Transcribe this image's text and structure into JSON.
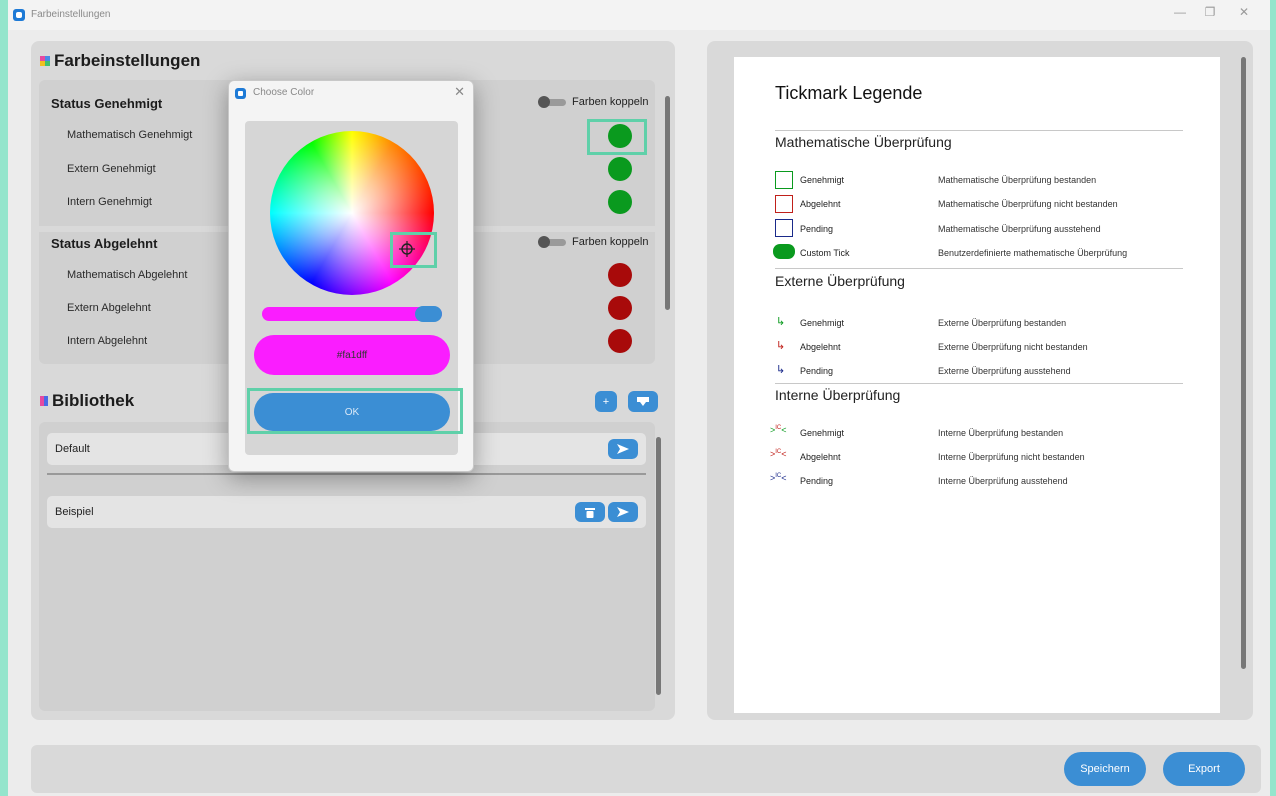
{
  "window": {
    "title": "Farbeinstellungen",
    "minimize": "—",
    "restore": "❐",
    "close": "✕"
  },
  "left": {
    "title": "Farbeinstellungen",
    "approved": {
      "title": "Status Genehmigt",
      "toggle": "Farben koppeln",
      "rows": [
        "Mathematisch Genehmigt",
        "Extern Genehmigt",
        "Intern Genehmigt"
      ],
      "color": "#0a9a1e"
    },
    "rejected": {
      "title": "Status Abgelehnt",
      "toggle": "Farben koppeln",
      "rows": [
        "Mathematisch Abgelehnt",
        "Extern Abgelehnt",
        "Intern Abgelehnt"
      ],
      "color": "#a80a0a"
    }
  },
  "library": {
    "title": "Bibliothek",
    "add": "+",
    "items": [
      {
        "name": "Default"
      },
      {
        "name": "Beispiel"
      }
    ]
  },
  "dialog": {
    "title": "Choose Color",
    "close": "✕",
    "hex": "#fa1dff",
    "ok": "OK"
  },
  "legend": {
    "title": "Tickmark Legende",
    "math": {
      "title": "Mathematische Überprüfung",
      "rows": [
        {
          "name": "Genehmigt",
          "desc": "Mathematische Überprüfung bestanden",
          "color": "#0a9a1e"
        },
        {
          "name": "Abgelehnt",
          "desc": "Mathematische Überprüfung nicht bestanden",
          "color": "#c0201a"
        },
        {
          "name": "Pending",
          "desc": "Mathematische Überprüfung ausstehend",
          "color": "#1a2a8a"
        },
        {
          "name": "Custom Tick",
          "desc": "Benutzerdefinierte mathematische Überprüfung",
          "color": "#0a9a1e"
        }
      ]
    },
    "ext": {
      "title": "Externe Überprüfung",
      "rows": [
        {
          "name": "Genehmigt",
          "desc": "Externe Überprüfung bestanden",
          "color": "#0a9a1e"
        },
        {
          "name": "Abgelehnt",
          "desc": "Externe Überprüfung nicht bestanden",
          "color": "#c0201a"
        },
        {
          "name": "Pending",
          "desc": "Externe Überprüfung ausstehend",
          "color": "#1a2a8a"
        }
      ]
    },
    "int": {
      "title": "Interne Überprüfung",
      "rows": [
        {
          "name": "Genehmigt",
          "desc": "Interne Überprüfung bestanden",
          "color": "#0a9a1e"
        },
        {
          "name": "Abgelehnt",
          "desc": "Interne Überprüfung nicht bestanden",
          "color": "#c0201a"
        },
        {
          "name": "Pending",
          "desc": "Interne Überprüfung ausstehend",
          "color": "#1a2a8a"
        }
      ],
      "mark": "IC"
    }
  },
  "footer": {
    "save": "Speichern",
    "export": "Export"
  }
}
